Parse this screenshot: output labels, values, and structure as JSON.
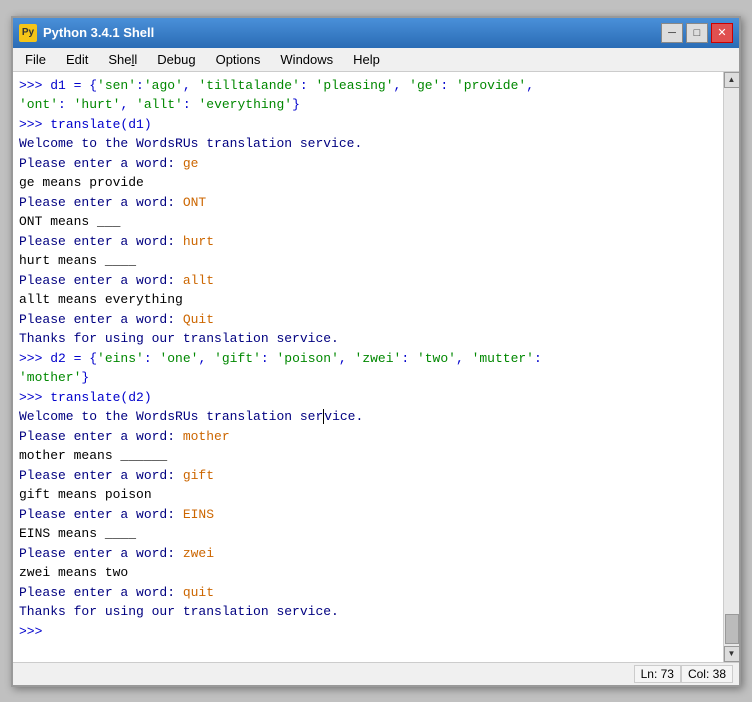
{
  "window": {
    "title": "Python 3.4.1 Shell",
    "icon_label": "Py"
  },
  "menu": {
    "items": [
      "File",
      "Edit",
      "Shell",
      "Debug",
      "Options",
      "Windows",
      "Help"
    ]
  },
  "title_controls": {
    "minimize": "─",
    "restore": "□",
    "close": "✕"
  },
  "status_bar": {
    "ln": "Ln: 73",
    "col": "Col: 38"
  },
  "content": [
    {
      "type": "prompt_line",
      "prompt": ">>> ",
      "code": "d1 = {'sen':'ago', 'tilltalande': 'pleasing', 'ge': 'provide',"
    },
    {
      "type": "continuation",
      "text": "'ont': 'hurt', 'allt': 'everything'}"
    },
    {
      "type": "prompt_line",
      "prompt": ">>> ",
      "code": "translate(d1)"
    },
    {
      "type": "output_line",
      "text": "Welcome to the WordsRUs translation service."
    },
    {
      "type": "output_line",
      "text": "Please enter a word: ge"
    },
    {
      "type": "output_line",
      "text": "ge means provide"
    },
    {
      "type": "output_line",
      "text": "Please enter a word: ONT"
    },
    {
      "type": "output_line",
      "text": "ONT means ___"
    },
    {
      "type": "output_line",
      "text": "Please enter a word: hurt"
    },
    {
      "type": "output_line",
      "text": "hurt means ____"
    },
    {
      "type": "output_line",
      "text": "Please enter a word: allt"
    },
    {
      "type": "output_line",
      "text": "allt means everything"
    },
    {
      "type": "output_line",
      "text": "Please enter a word: Quit"
    },
    {
      "type": "output_line",
      "text": "Thanks for using our translation service."
    },
    {
      "type": "prompt_line",
      "prompt": ">>> ",
      "code": "d2 = {'eins': 'one', 'gift': 'poison', 'zwei': 'two', 'mutter':"
    },
    {
      "type": "continuation",
      "text": "'mother'}"
    },
    {
      "type": "prompt_line",
      "prompt": ">>> ",
      "code": "translate(d2)"
    },
    {
      "type": "output_line",
      "text": "Welcome to the WordsRUs translation service."
    },
    {
      "type": "output_line",
      "text": "Please enter a word: mother"
    },
    {
      "type": "output_line",
      "text": "mother means ______"
    },
    {
      "type": "output_line",
      "text": "Please enter a word: gift"
    },
    {
      "type": "output_line",
      "text": "gift means poison"
    },
    {
      "type": "output_line",
      "text": "Please enter a word: EINS"
    },
    {
      "type": "output_line",
      "text": "EINS means ____"
    },
    {
      "type": "output_line",
      "text": "Please enter a word: zwei"
    },
    {
      "type": "output_line",
      "text": "zwei means two"
    },
    {
      "type": "output_line",
      "text": "Please enter a word: quit"
    },
    {
      "type": "output_line",
      "text": "Thanks for using our translation service."
    },
    {
      "type": "prompt_only",
      "prompt": ">>> "
    }
  ]
}
